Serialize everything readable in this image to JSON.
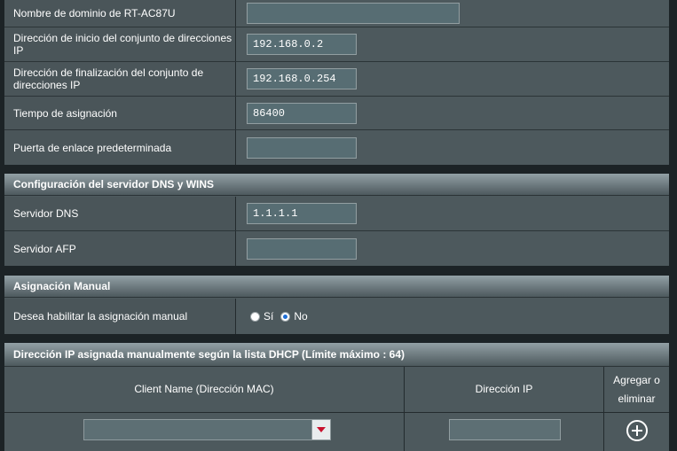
{
  "lan_dhcp": {
    "domain_name": {
      "label": "Nombre de dominio de RT-AC87U",
      "value": ""
    },
    "pool_start": {
      "label": "Dirección de inicio del conjunto de direcciones IP",
      "value": "192.168.0.2"
    },
    "pool_end": {
      "label": "Dirección de finalización del conjunto de direcciones IP",
      "value": "192.168.0.254"
    },
    "lease_time": {
      "label": "Tiempo de asignación",
      "value": "86400"
    },
    "gateway": {
      "label": "Puerta de enlace predeterminada",
      "value": ""
    }
  },
  "dns_wins": {
    "title": "Configuración del servidor DNS y WINS",
    "dns_server": {
      "label": "Servidor DNS",
      "value": "1.1.1.1"
    },
    "afp_server": {
      "label": "Servidor AFP",
      "value": ""
    }
  },
  "manual": {
    "title": "Asignación Manual",
    "enable_label": "Desea habilitar la asignación manual",
    "option_yes": "Sí",
    "option_no": "No",
    "selected": "No"
  },
  "dhcp_list": {
    "title": "Dirección IP asignada manualmente según la lista DHCP (Límite máximo : 64)",
    "col_client": "Client Name (Dirección MAC)",
    "col_ip": "Dirección IP",
    "col_action": "Agregar o eliminar",
    "client_select_value": "",
    "ip_value": ""
  }
}
